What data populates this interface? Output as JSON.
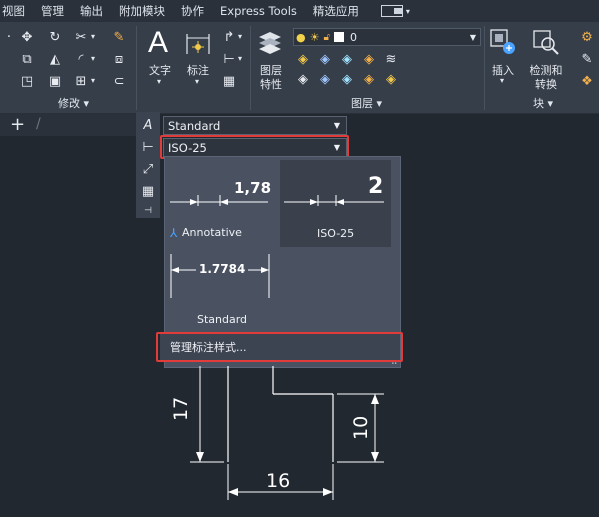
{
  "menubar": {
    "items": [
      "视图",
      "管理",
      "输出",
      "附加模块",
      "协作",
      "Express Tools",
      "精选应用"
    ]
  },
  "ribbon": {
    "modify_panel_label": "修改 ▾",
    "annotation": {
      "text_label": "文字",
      "dim_label": "标注"
    },
    "layers": {
      "properties_label_line1": "图层",
      "properties_label_line2": "特性",
      "current_layer": "0",
      "panel_label": "图层 ▾"
    },
    "block": {
      "insert_label": "插入",
      "detect_label_line1": "检测和",
      "detect_label_line2": "转换",
      "panel_label": "块 ▾"
    }
  },
  "toolbar": {
    "text_style": "Standard",
    "dim_style": "ISO-25"
  },
  "dropdown": {
    "annotative": {
      "value": "1,78",
      "label": "Annotative"
    },
    "iso25": {
      "value": "2",
      "label": "ISO-25"
    },
    "standard": {
      "value": "1.7784",
      "label": "Standard"
    },
    "manage_label": "管理标注样式..."
  },
  "drawing": {
    "dim_17": "17",
    "dim_10": "10",
    "dim_16": "16"
  },
  "colors": {
    "background": "#212830",
    "ribbon": "#363e4a",
    "highlight": "#e33a3a",
    "accent": "#4aa3ff"
  }
}
